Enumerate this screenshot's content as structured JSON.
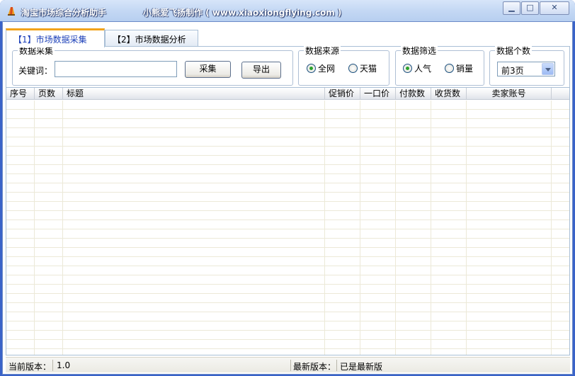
{
  "window": {
    "title": "淘宝市场综合分析助手",
    "subtitle": "小熊爱飞扬制作 ( www.xiaoxiongflying.com )",
    "minimize_glyph": "▁",
    "maximize_glyph": "□",
    "close_glyph": "✕"
  },
  "tabs": [
    {
      "label": "【1】市场数据采集"
    },
    {
      "label": "【2】市场数据分析"
    }
  ],
  "collect": {
    "legend": "数据采集",
    "keyword_label": "关键词：",
    "keyword_value": "",
    "collect_button": "采集",
    "export_button": "导出"
  },
  "source": {
    "legend": "数据来源",
    "options": [
      {
        "label": "全网",
        "checked": true
      },
      {
        "label": "天猫",
        "checked": false
      }
    ]
  },
  "filter": {
    "legend": "数据筛选",
    "options": [
      {
        "label": "人气",
        "checked": true
      },
      {
        "label": "销量",
        "checked": false
      }
    ]
  },
  "count": {
    "legend": "数据个数",
    "selected": "前3页"
  },
  "table": {
    "columns": [
      "序号",
      "页数",
      "标题",
      "促销价",
      "一口价",
      "付款数",
      "收货数",
      "卖家账号"
    ],
    "rows": []
  },
  "status": {
    "current_label": "当前版本：",
    "current_value": "1.0",
    "latest_label": "最新版本：",
    "latest_value": "已是最新版"
  },
  "colors": {
    "accent_tab": "#f2a31a",
    "active_tab_text": "#1b3fb8",
    "radio_dot": "#2ba22b"
  }
}
